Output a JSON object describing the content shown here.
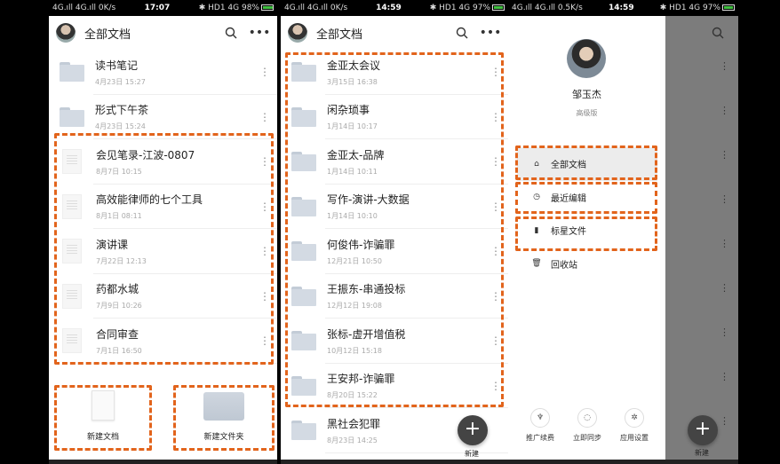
{
  "status": {
    "s1": {
      "left": "4G.ıll 4G.ıll 0K/s",
      "time": "17:07",
      "right": "✱ HD1 4G 98%"
    },
    "s2": {
      "left": "4G.ıll 4G.ıll 0K/s",
      "time": "14:59",
      "right": "✱ HD1 4G 97%"
    },
    "s3": {
      "left": "4G.ıll 4G.ıll 0.5K/s",
      "time": "14:59",
      "right": "✱ HD1 4G 97%"
    }
  },
  "screen1": {
    "title": "全部文档",
    "items": [
      {
        "type": "folder",
        "name": "读书笔记",
        "date": "4月23日 15:27"
      },
      {
        "type": "folder",
        "name": "形式下午茶",
        "date": "4月23日 15:24"
      },
      {
        "type": "doc",
        "name": "会见笔录-江波-0807",
        "date": "8月7日 10:15"
      },
      {
        "type": "doc",
        "name": "高效能律师的七个工具",
        "date": "8月1日 08:11"
      },
      {
        "type": "doc",
        "name": "演讲课",
        "date": "7月22日 12:13"
      },
      {
        "type": "doc",
        "name": "药都水城",
        "date": "7月9日 10:26"
      },
      {
        "type": "doc",
        "name": "合同审查",
        "date": "7月1日 16:50"
      }
    ],
    "new_doc": "新建文档",
    "new_folder": "新建文件夹"
  },
  "screen2": {
    "title": "全部文档",
    "items": [
      {
        "name": "金亚太会议",
        "date": "3月15日 16:38"
      },
      {
        "name": "闲杂琐事",
        "date": "1月14日 10:17"
      },
      {
        "name": "金亚太-品牌",
        "date": "1月14日 10:11"
      },
      {
        "name": "写作-演讲-大数据",
        "date": "1月14日 10:10"
      },
      {
        "name": "何俊伟-诈骗罪",
        "date": "12月21日 10:50"
      },
      {
        "name": "王振东-串通投标",
        "date": "12月12日 19:08"
      },
      {
        "name": "张标-虚开增值税",
        "date": "10月12日 15:18"
      },
      {
        "name": "王安邦-诈骗罪",
        "date": "8月20日 15:22"
      },
      {
        "name": "黑社会犯罪",
        "date": "8月23日 14:25"
      }
    ],
    "fab_label": "新建"
  },
  "screen3": {
    "user_name": "邹玉杰",
    "user_level": "高级版",
    "menu": [
      {
        "icon": "home-icon",
        "glyph": "⌂",
        "label": "全部文档"
      },
      {
        "icon": "clock-icon",
        "glyph": "◷",
        "label": "最近编辑"
      },
      {
        "icon": "bookmark-icon",
        "glyph": "▮",
        "label": "标星文件"
      },
      {
        "icon": "trash-icon",
        "glyph": "🗑",
        "label": "回收站"
      }
    ],
    "bottom": [
      {
        "icon": "rocket-icon",
        "glyph": "♆",
        "label": "推广续费"
      },
      {
        "icon": "sync-icon",
        "glyph": "◌",
        "label": "立即同步"
      },
      {
        "icon": "settings-icon",
        "glyph": "✲",
        "label": "应用设置"
      }
    ],
    "fab_label": "新建"
  },
  "colors": {
    "highlight": "#e2641c"
  }
}
